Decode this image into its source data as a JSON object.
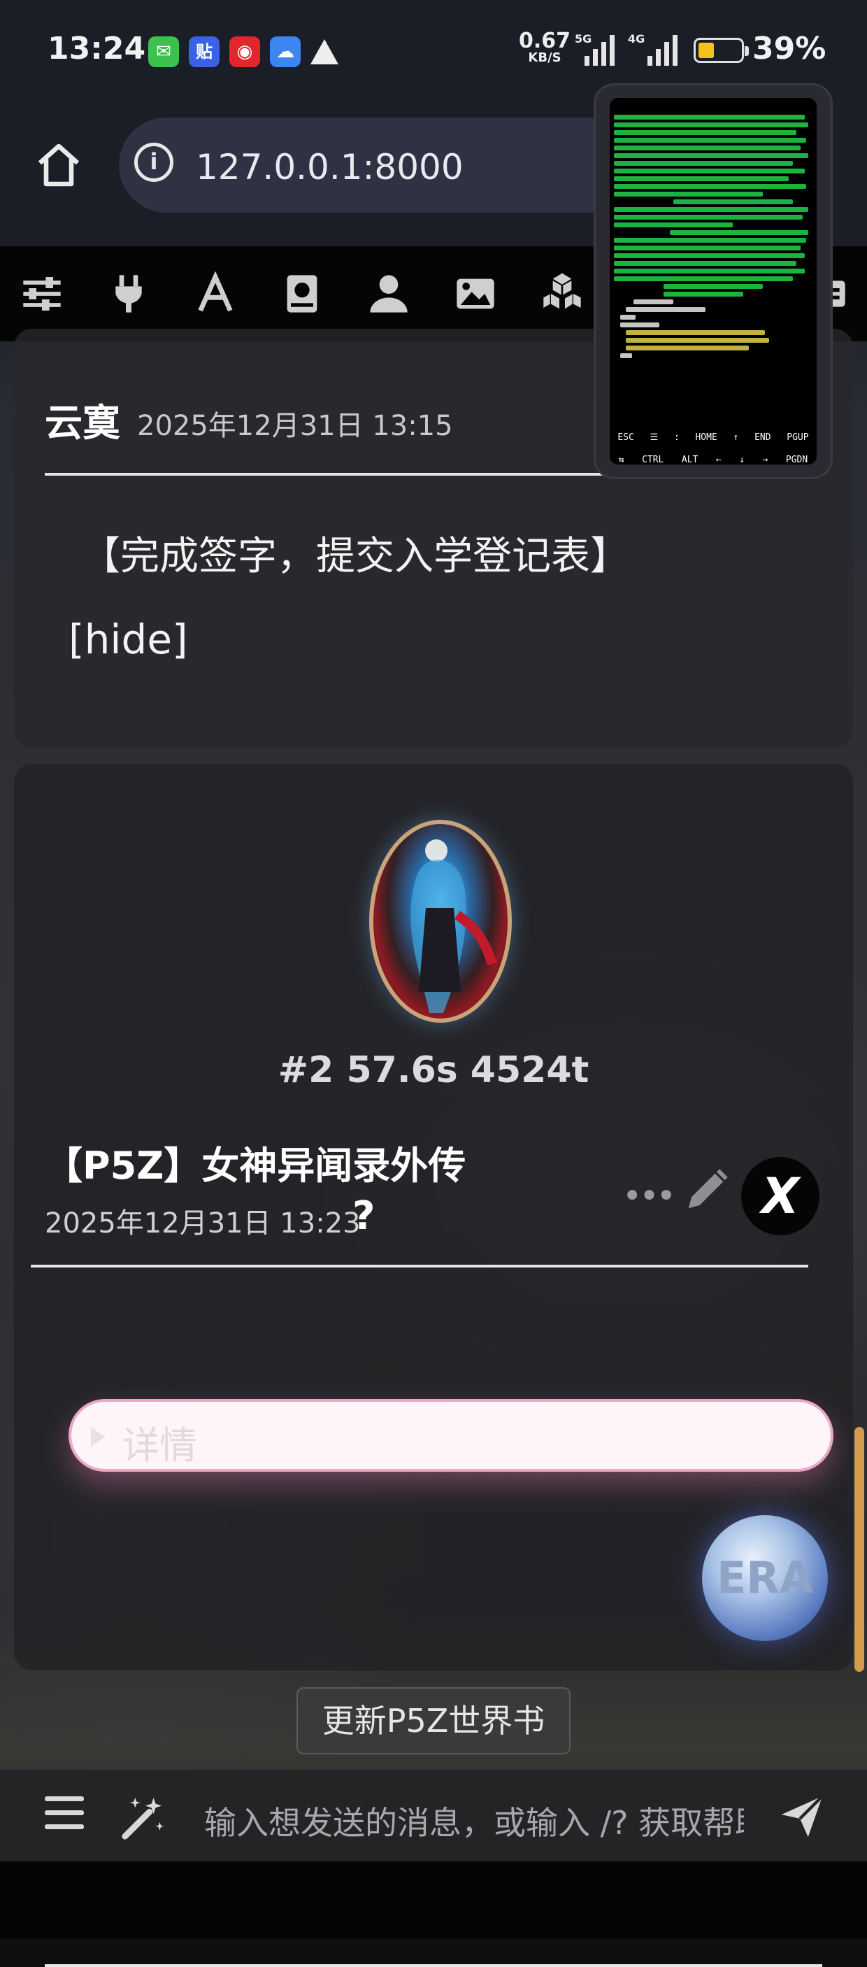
{
  "status_bar": {
    "time": "13:24",
    "app_icons": [
      {
        "name": "chat-app-icon",
        "glyph": "✉",
        "color": "#3cc04e"
      },
      {
        "name": "tieba-app-icon",
        "glyph": "贴",
        "color": "#3a62e8"
      },
      {
        "name": "music-app-icon",
        "glyph": "◉",
        "color": "#e3262b"
      },
      {
        "name": "weather-app-icon",
        "glyph": "☁",
        "color": "#3b86f0"
      }
    ],
    "net_speed": "0.67",
    "net_unit": "KB/S",
    "sig1_label": "5G",
    "sig2_label": "4G",
    "battery_pct": "39%",
    "battery_level": 0.39
  },
  "browser": {
    "url": "127.0.0.1:8000",
    "info_glyph": "i"
  },
  "toolbar": {
    "icons": [
      "sliders-icon",
      "plug-icon",
      "font-icon",
      "book-icon",
      "user-icon",
      "image-icon",
      "cubes-icon",
      "contact-card-icon"
    ]
  },
  "message_user": {
    "name": "云寞",
    "date": "2025年12月31日 13:15",
    "text": "【完成签字，提交入学登记表】",
    "hide_tag": "[hide]"
  },
  "message_char": {
    "stats": "#2 57.6s 4524t",
    "name": "【P5Z】女神异闻录外传",
    "date": "2025年12月31日 13:23",
    "question_glyph": "?",
    "more_glyph": "•••",
    "x_glyph": "X",
    "details_label": "详情"
  },
  "era_button": {
    "label": "ERA"
  },
  "update_button": {
    "label": "更新P5Z世界书"
  },
  "input_bar": {
    "placeholder": "输入想发送的消息，或输入 /? 获取帮助"
  },
  "terminal": {
    "keys_row1": [
      "ESC",
      "☰",
      ":",
      "HOME",
      "↑",
      "END",
      "PGUP"
    ],
    "keys_row2": [
      "⇆",
      "CTRL",
      "ALT",
      "←",
      "↓",
      "→",
      "PGDN"
    ]
  }
}
